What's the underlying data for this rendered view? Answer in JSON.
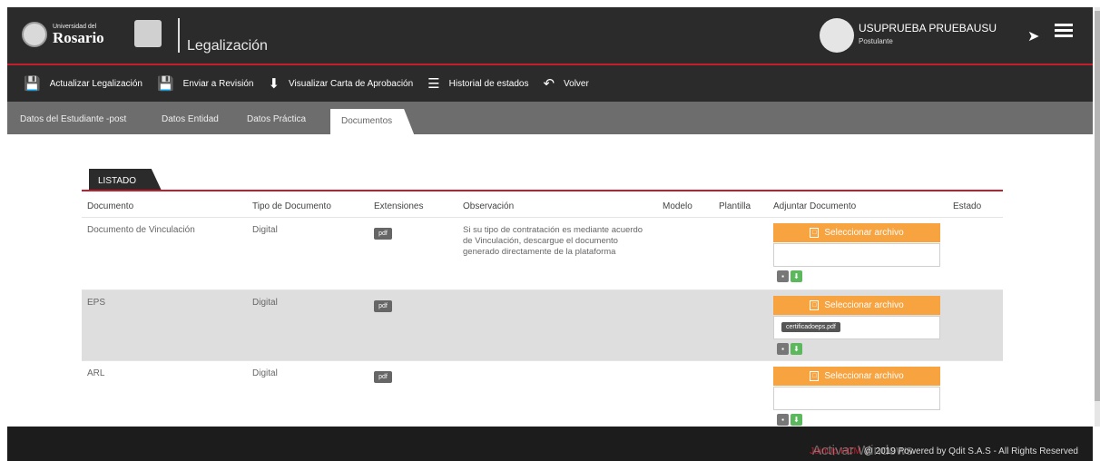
{
  "header": {
    "logo_small": "Universidad del",
    "logo_big": "Rosario",
    "app_title": "Legalización",
    "user_name": "USUPRUEBA PRUEBAUSU",
    "user_role": "Postulante"
  },
  "toolbar": {
    "actualizar": "Actualizar Legalización",
    "enviar": "Enviar a Revisión",
    "visualizar": "Visualizar Carta de Aprobación",
    "historial": "Historial de estados",
    "volver": "Volver"
  },
  "tabs": [
    "Datos del Estudiante -post",
    "Datos Entidad",
    "Datos Práctica",
    "Documentos"
  ],
  "listado": {
    "title": "LISTADO",
    "columns": [
      "Documento",
      "Tipo de Documento",
      "Extensiones",
      "Observación",
      "Modelo",
      "Plantilla",
      "Adjuntar Documento",
      "Estado"
    ],
    "select_label": "Seleccionar archivo",
    "ext_label": "pdf",
    "rows": [
      {
        "documento": "Documento de Vinculación",
        "tipo": "Digital",
        "observacion": "Si su tipo de contratación es mediante acuerdo de Vinculación, descargue el documento generado directamente de la plataforma",
        "file": ""
      },
      {
        "documento": "EPS",
        "tipo": "Digital",
        "observacion": "",
        "file": "certificadoeps.pdf"
      },
      {
        "documento": "ARL",
        "tipo": "Digital",
        "observacion": "",
        "file": ""
      }
    ]
  },
  "footer": {
    "brand": "JoinUp HCM",
    "text": " @ 2019 Powered by Qdit S.A.S  -  All Rights Reserved",
    "watermark": "Activar Windows"
  },
  "icons": {
    "save": "save-icon",
    "download": "download-icon",
    "list": "list-icon",
    "back": "back-icon",
    "logout": "logout-icon",
    "menu": "hamburger-icon"
  },
  "colors": {
    "accent_red": "#c31e2e",
    "orange_button": "#f6a340",
    "dark_bar": "#2b2b2b",
    "green": "#5cb85c"
  }
}
